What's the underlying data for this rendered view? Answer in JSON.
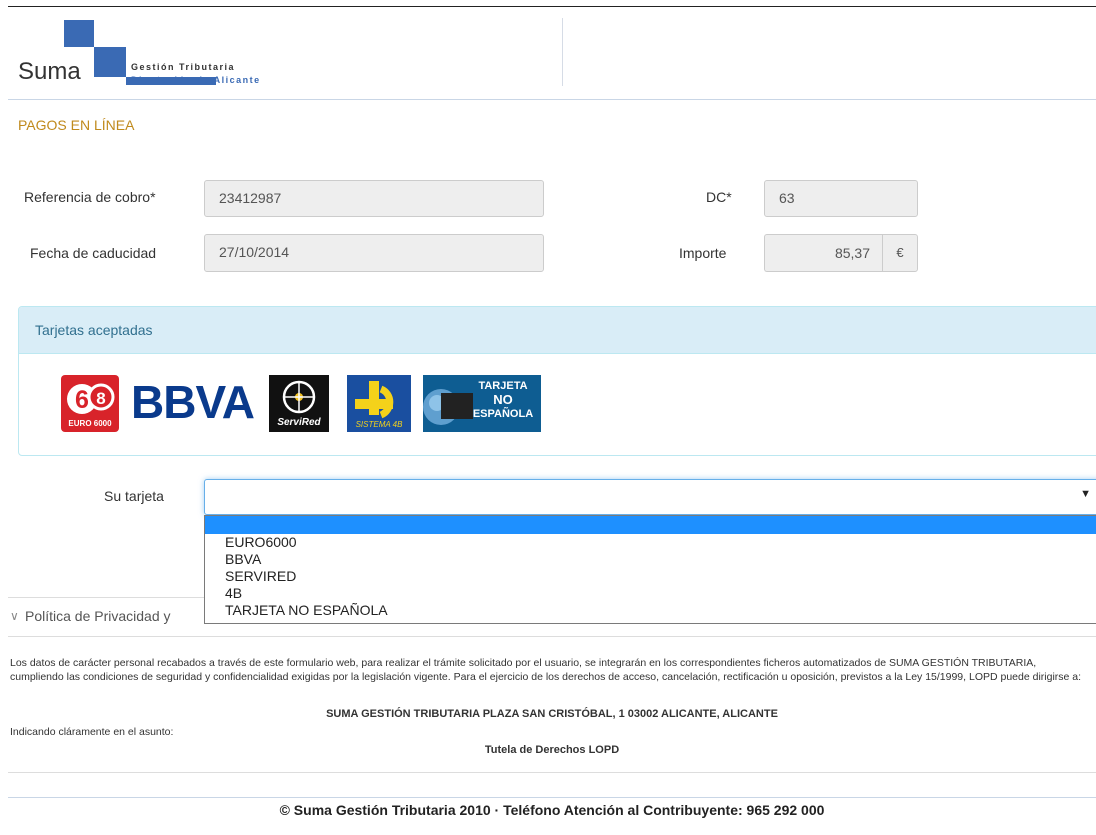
{
  "brand": {
    "name": "Suma",
    "tagline_1": "Gestión Tributaria",
    "tagline_2": "Diputación de Alicante",
    "color": "#3a6ab4"
  },
  "page_title": "PAGOS EN LÍNEA",
  "form": {
    "reference_label": "Referencia de cobro*",
    "reference_value": "23412987",
    "dc_label": "DC*",
    "dc_value": "63",
    "expiry_label": "Fecha de caducidad",
    "expiry_value": "27/10/2014",
    "amount_label": "Importe",
    "amount_value": "85,37",
    "currency": "€"
  },
  "cards_panel": {
    "title": "Tarjetas aceptadas",
    "cards": [
      {
        "name": "EURO 6000",
        "logo_text": "EURO 6000",
        "icon": "euro6000-logo"
      },
      {
        "name": "BBVA",
        "logo_text": "BBVA",
        "icon": "bbva-logo"
      },
      {
        "name": "ServiRed",
        "logo_text": "ServiRed",
        "icon": "servired-logo"
      },
      {
        "name": "Sistema 4B",
        "logo_text": "SISTEMA 4B",
        "icon": "sistema4b-logo"
      },
      {
        "name": "Tarjeta no española",
        "logo_line1": "TARJETA",
        "logo_line2": "NO",
        "logo_line3": "ESPAÑOLA",
        "icon": "foreign-card-logo"
      }
    ]
  },
  "card_select": {
    "label": "Su tarjeta",
    "value": "",
    "options": [
      "EURO6000",
      "BBVA",
      "SERVIRED",
      "4B",
      "TARJETA NO ESPAÑOLA"
    ]
  },
  "privacy": {
    "toggle_label": "Política de Privacidad y",
    "text": "Los datos de carácter personal recabados a través de este formulario web, para realizar el trámite solicitado por el usuario, se integrarán en los correspondientes ficheros automatizados de SUMA GESTIÓN TRIBUTARIA, cumpliendo las condiciones de seguridad y confidencialidad exigidas por la legislación vigente. Para el ejercicio de los derechos de acceso, cancelación, rectificación u oposición, previstos a la Ley 15/1999, LOPD puede dirigirse a:",
    "address": "SUMA GESTIÓN TRIBUTARIA PLAZA SAN CRISTÓBAL, 1 03002 ALICANTE, ALICANTE",
    "subject_label": "Indicando cláramente en el asunto:",
    "subject_value": "Tutela de Derechos LOPD"
  },
  "footer": {
    "text": "© Suma Gestión Tributaria 2010 · Teléfono Atención al Contribuyente: 965 292 000"
  }
}
